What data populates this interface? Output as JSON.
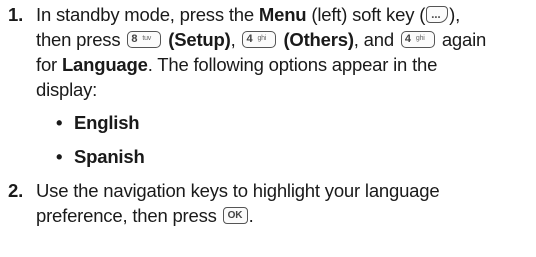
{
  "step1": {
    "number": "1.",
    "line1": {
      "pre": "In standby mode, press the ",
      "menu": "Menu",
      "mid": " (left) soft key (",
      "post": "),"
    },
    "line2": {
      "pre": "then press ",
      "key8": "8",
      "key8_letters": "tuv",
      "setup": "(Setup)",
      "sep1": ", ",
      "key4": "4",
      "key4_letters": "ghi",
      "others": "(Others)",
      "mid": ", and ",
      "key4b": "4",
      "key4b_letters": "ghi",
      "post": " again"
    },
    "line3": {
      "pre": "for ",
      "language": "Language",
      "post": ". The following options appear in the"
    },
    "line4": "display:",
    "options": [
      "English",
      "Spanish"
    ]
  },
  "step2": {
    "number": "2.",
    "line1": "Use the navigation keys to highlight your language",
    "line2_pre": "preference, then press ",
    "ok_key": "OK",
    "line2_post": "."
  },
  "bullet_glyph": "•",
  "icons": [
    "soft-key-icon",
    "key-8-icon",
    "key-4-icon",
    "key-4-icon",
    "ok-key-icon"
  ]
}
